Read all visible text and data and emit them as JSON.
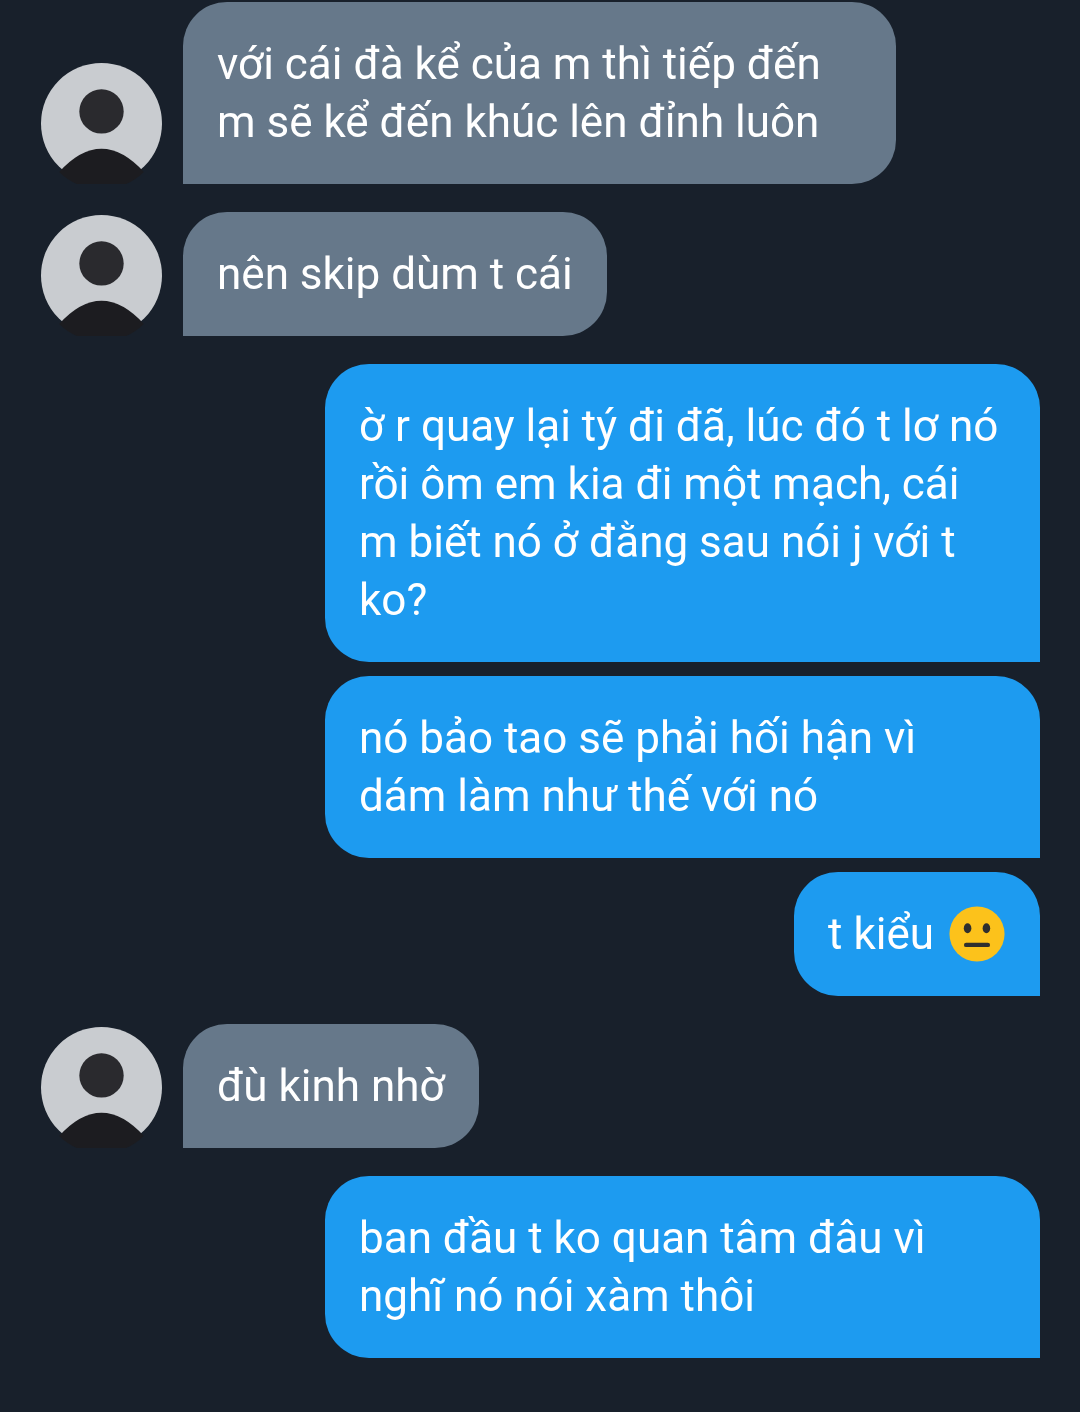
{
  "messages": [
    {
      "kind": "incoming",
      "text": "với cái đà kể của m thì tiếp đến m sẽ kể đến khúc lên đỉnh luôn"
    },
    {
      "kind": "incoming",
      "text": "nên skip dùm t cái"
    },
    {
      "kind": "outgoing",
      "text": "ờ r quay lại tý đi đã, lúc đó t lơ nó rồi ôm em kia đi một mạch, cái m biết nó ở đằng sau nói j với t ko?"
    },
    {
      "kind": "outgoing",
      "text": "nó bảo tao sẽ phải hối hận vì dám làm như thế với nó"
    },
    {
      "kind": "emotive",
      "text": "t kiểu"
    },
    {
      "kind": "incoming",
      "text": "đù kinh nhờ"
    },
    {
      "kind": "outgoing",
      "text": "ban đầu t ko quan tâm đâu vì nghĩ nó nói xàm thôi"
    }
  ]
}
